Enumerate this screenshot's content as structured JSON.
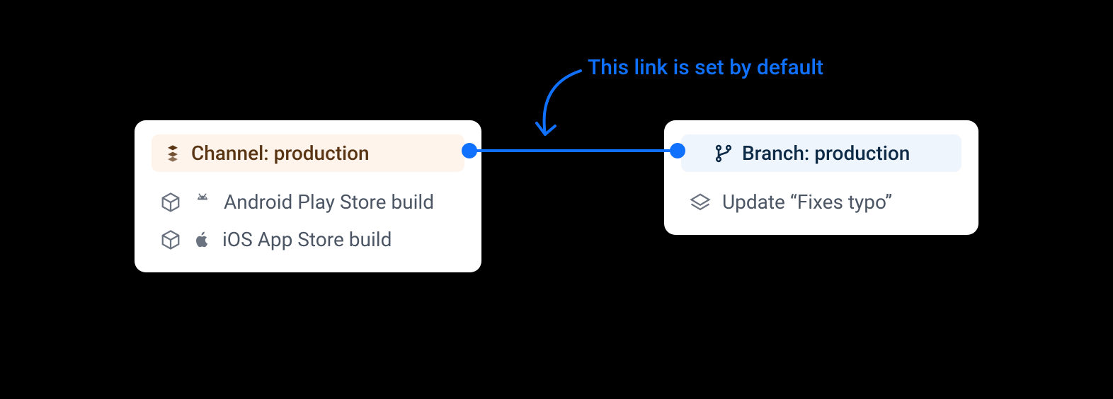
{
  "annotation": {
    "text": "This link is set by default"
  },
  "channel": {
    "header": "Channel: production",
    "builds": [
      {
        "platform": "android",
        "label": "Android Play Store build"
      },
      {
        "platform": "ios",
        "label": "iOS App Store build"
      }
    ]
  },
  "branch": {
    "header": "Branch: production",
    "updates": [
      {
        "label": "Update “Fixes typo”"
      }
    ]
  },
  "colors": {
    "link": "#1071ff",
    "channel_bg": "#fff4ec",
    "channel_fg": "#5a3514",
    "branch_bg": "#eef5fc",
    "branch_fg": "#0d2a47"
  }
}
